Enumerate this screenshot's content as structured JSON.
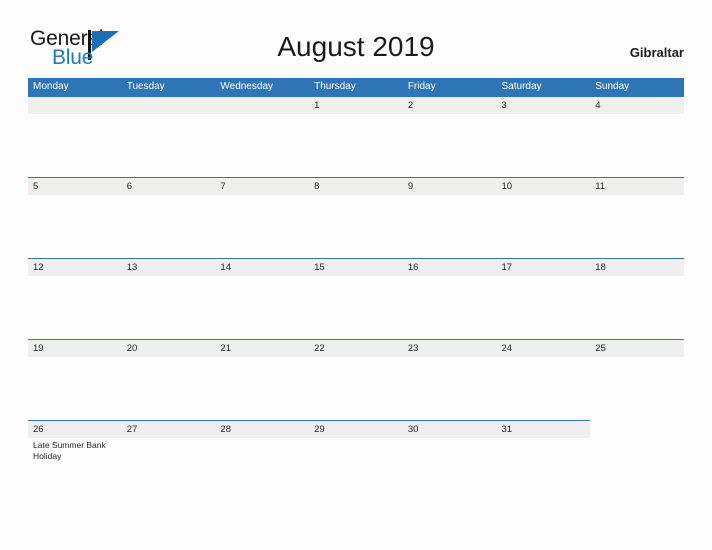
{
  "brand": {
    "name_part1": "General",
    "name_part2": "Blue",
    "logo_icon": "flag-triangle-icon",
    "colors": {
      "dark": "#111111",
      "blue": "#1f7ac4"
    }
  },
  "header": {
    "title": "August 2019",
    "locale": "Gibraltar"
  },
  "calendar": {
    "month": "August",
    "year": "2019",
    "accent_color": "#2f75b5",
    "band_color": "#efefef",
    "weekdays": [
      "Monday",
      "Tuesday",
      "Wednesday",
      "Thursday",
      "Friday",
      "Saturday",
      "Sunday"
    ],
    "weeks": [
      {
        "band": "full",
        "days": [
          {
            "number": "",
            "events": []
          },
          {
            "number": "",
            "events": []
          },
          {
            "number": "",
            "events": []
          },
          {
            "number": "1",
            "events": []
          },
          {
            "number": "2",
            "events": []
          },
          {
            "number": "3",
            "events": []
          },
          {
            "number": "4",
            "events": []
          }
        ]
      },
      {
        "band": "full",
        "days": [
          {
            "number": "5",
            "events": []
          },
          {
            "number": "6",
            "events": []
          },
          {
            "number": "7",
            "events": []
          },
          {
            "number": "8",
            "events": []
          },
          {
            "number": "9",
            "events": []
          },
          {
            "number": "10",
            "events": []
          },
          {
            "number": "11",
            "events": []
          }
        ]
      },
      {
        "band": "full",
        "days": [
          {
            "number": "12",
            "events": []
          },
          {
            "number": "13",
            "events": []
          },
          {
            "number": "14",
            "events": []
          },
          {
            "number": "15",
            "events": []
          },
          {
            "number": "16",
            "events": []
          },
          {
            "number": "17",
            "events": []
          },
          {
            "number": "18",
            "events": []
          }
        ]
      },
      {
        "band": "full",
        "days": [
          {
            "number": "19",
            "events": []
          },
          {
            "number": "20",
            "events": []
          },
          {
            "number": "21",
            "events": []
          },
          {
            "number": "22",
            "events": []
          },
          {
            "number": "23",
            "events": []
          },
          {
            "number": "24",
            "events": []
          },
          {
            "number": "25",
            "events": []
          }
        ]
      },
      {
        "band": "partial",
        "days": [
          {
            "number": "26",
            "events": [
              "Late Summer Bank Holiday"
            ]
          },
          {
            "number": "27",
            "events": []
          },
          {
            "number": "28",
            "events": []
          },
          {
            "number": "29",
            "events": []
          },
          {
            "number": "30",
            "events": []
          },
          {
            "number": "31",
            "events": []
          },
          {
            "number": "",
            "events": []
          }
        ]
      }
    ]
  }
}
